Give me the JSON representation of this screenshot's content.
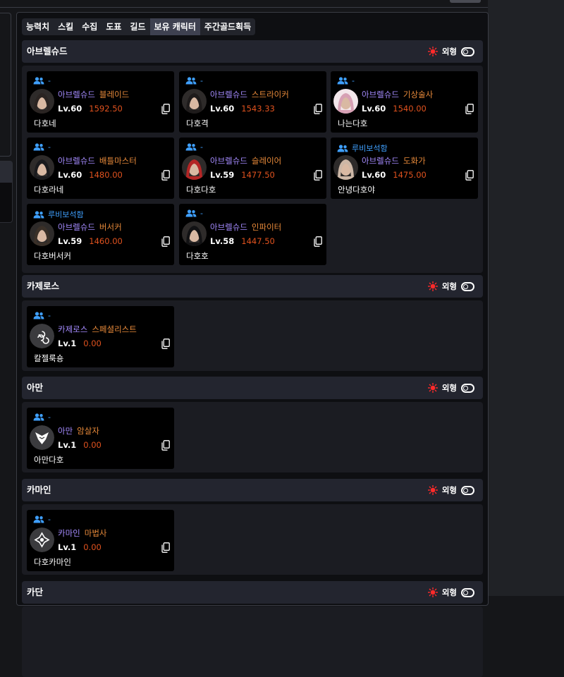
{
  "tabs": [
    {
      "label": "능력치"
    },
    {
      "label": "스킬"
    },
    {
      "label": "수집"
    },
    {
      "label": "도표"
    },
    {
      "label": "길드"
    },
    {
      "label": "보유 캐릭터",
      "active": true
    },
    {
      "label": "주간골드획득"
    }
  ],
  "toggle_label": "외형",
  "colors": {
    "accent_red": "#ff2a2a",
    "guild_blue": "#3fa0ff",
    "server_purple": "#a58bff",
    "class_orange": "#e88a3a",
    "item_level": "#e0521e"
  },
  "servers": [
    {
      "name": "아브렐슈드",
      "characters": [
        {
          "guild": "-",
          "server": "아브렐슈드",
          "class": "블레이드",
          "level": "Lv.60",
          "item_level": "1592.50",
          "nickname": "다호네",
          "avatar": "portrait-dark-hood-icon"
        },
        {
          "guild": "-",
          "server": "아브렐슈드",
          "class": "스트라이커",
          "level": "Lv.60",
          "item_level": "1543.33",
          "nickname": "다호격",
          "avatar": "portrait-dark-hair-icon"
        },
        {
          "guild": "-",
          "server": "아브렐슈드",
          "class": "기상술사",
          "level": "Lv.60",
          "item_level": "1540.00",
          "nickname": "나는다호",
          "avatar": "portrait-pink-hair-icon"
        },
        {
          "guild": "-",
          "server": "아브렐슈드",
          "class": "배틀마스터",
          "level": "Lv.60",
          "item_level": "1480.00",
          "nickname": "다호라네",
          "avatar": "portrait-dark-cap-icon"
        },
        {
          "guild": "-",
          "server": "아브렐슈드",
          "class": "슬레이어",
          "level": "Lv.59",
          "item_level": "1477.50",
          "nickname": "다호다호",
          "avatar": "portrait-red-hair-icon"
        },
        {
          "guild": "루비보석함",
          "server": "아브렐슈드",
          "class": "도화가",
          "level": "Lv.60",
          "item_level": "1475.00",
          "nickname": "안녕다호야",
          "avatar": "portrait-light-hair-icon"
        },
        {
          "guild": "루비보석함",
          "server": "아브렐슈드",
          "class": "버서커",
          "level": "Lv.59",
          "item_level": "1460.00",
          "nickname": "다호버서커",
          "avatar": "portrait-warrior-icon"
        },
        {
          "guild": "-",
          "server": "아브렐슈드",
          "class": "인파이터",
          "level": "Lv.58",
          "item_level": "1447.50",
          "nickname": "다호호",
          "avatar": "portrait-black-hair-icon"
        }
      ]
    },
    {
      "name": "카제로스",
      "characters": [
        {
          "guild": "-",
          "server": "카제로스",
          "class": "스페셜리스트",
          "level": "Lv.1",
          "item_level": "0.00",
          "nickname": "칼젤룩숑",
          "avatar": "specialist-emblem-icon"
        }
      ]
    },
    {
      "name": "아만",
      "characters": [
        {
          "guild": "-",
          "server": "아만",
          "class": "암살자",
          "level": "Lv.1",
          "item_level": "0.00",
          "nickname": "아만다호",
          "avatar": "assassin-emblem-icon"
        }
      ]
    },
    {
      "name": "카마인",
      "characters": [
        {
          "guild": "-",
          "server": "카마인",
          "class": "마법사",
          "level": "Lv.1",
          "item_level": "0.00",
          "nickname": "다호카마인",
          "avatar": "mage-emblem-icon"
        }
      ]
    },
    {
      "name": "카단",
      "characters": []
    }
  ]
}
